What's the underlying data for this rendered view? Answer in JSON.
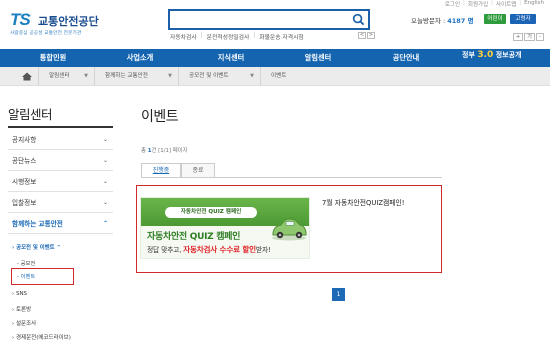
{
  "top_links": [
    "로그인",
    "회원가입",
    "사이트맵",
    "English"
  ],
  "logo": {
    "mark": "TS",
    "name": "교통안전공단",
    "tagline": "사람중심 공공성 교통안전 전문기관"
  },
  "search": {
    "value": "",
    "placeholder": ""
  },
  "quick_links": [
    "자동차검사",
    "운전적성정밀검사",
    "화물운송 자격시험"
  ],
  "quick_nav": [
    "<",
    ">"
  ],
  "visitors": {
    "label": "오늘방문자 :",
    "count": "4187 명"
  },
  "buttons": {
    "child": "어린이",
    "elder": "고령자"
  },
  "zoom": [
    "+",
    "기",
    "-"
  ],
  "gnb": [
    "통합민원",
    "사업소개",
    "지식센터",
    "알림센터",
    "공단안내"
  ],
  "gnb_brand": {
    "prefix": "정부",
    "mark": "3.0",
    "suffix": "정보공개"
  },
  "breadcrumb": [
    "알림센터",
    "함께하는 교통안전",
    "공모전 및 이벤트",
    "이벤트"
  ],
  "sidebar": {
    "title": "알림센터",
    "items": [
      "공지사항",
      "공단뉴스",
      "시행정보",
      "입찰정보",
      "함께하는 교통안전"
    ],
    "sub_heading": "공모전 및 이벤트",
    "sub_items": [
      "공모전",
      "이벤트"
    ],
    "more_items": [
      "SNS",
      "토론방",
      "설문조사",
      "경제운전(에코드라이브)"
    ]
  },
  "main": {
    "title": "이벤트",
    "count_prefix": "총",
    "count_value": "1",
    "count_suffix": "건 [1/1] 페이지",
    "tabs": [
      "진행중",
      "종료"
    ],
    "event": {
      "banner_badge": "자동차안전 QUIZ 캠페인",
      "banner_main": "자동차안전 QUIZ 캠페인",
      "banner_sub_plain": "정답 맞추고,",
      "banner_sub_highlight": "자동차검사 수수료 할인",
      "banner_sub_end": "받자!",
      "title": "7월 자동차안전QUIZ캠페인!"
    },
    "pagination": [
      "1"
    ]
  },
  "colors": {
    "brand_blue": "#1464b0",
    "highlight_red": "#d12a2a",
    "green": "#2e9b3d"
  }
}
